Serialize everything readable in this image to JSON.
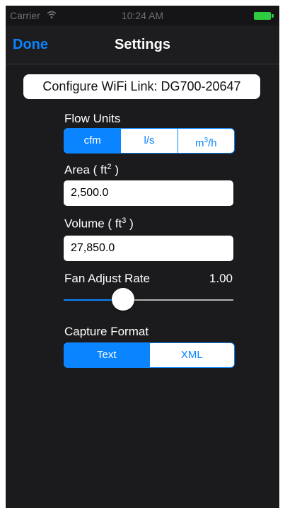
{
  "status_bar": {
    "carrier": "Carrier",
    "time": "10:24 AM"
  },
  "nav": {
    "done_label": "Done",
    "title": "Settings"
  },
  "wifi_link": {
    "label": "Configure WiFi Link: DG700-20647"
  },
  "flow_units": {
    "label": "Flow Units",
    "options": [
      "cfm",
      "l/s",
      "m"
    ],
    "option3_suffix": "/h",
    "option3_superscript": "3",
    "selected": "cfm"
  },
  "area": {
    "label_prefix": "Area ( ft",
    "label_superscript": "2",
    "label_suffix": " )",
    "value": "2,500.0"
  },
  "volume": {
    "label_prefix": "Volume ( ft",
    "label_superscript": "3",
    "label_suffix": " )",
    "value": "27,850.0"
  },
  "fan_adjust": {
    "label": "Fan Adjust Rate",
    "value_text": "1.00",
    "slider_fraction": 0.35
  },
  "capture_format": {
    "label": "Capture Format",
    "options": [
      "Text",
      "XML"
    ],
    "selected": "Text"
  },
  "colors": {
    "accent": "#0a84ff",
    "background": "#1b1b1d",
    "battery": "#2ecc40"
  }
}
